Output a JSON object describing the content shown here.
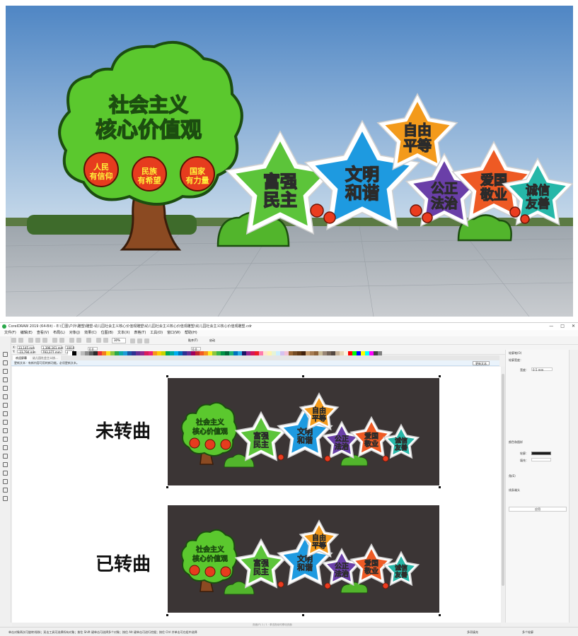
{
  "render": {
    "tree_title_line1": "社会主义",
    "tree_title_line2": "核心价值观",
    "apples": [
      {
        "line1": "人民",
        "line2": "有信仰"
      },
      {
        "line1": "民族",
        "line2": "有希望"
      },
      {
        "line1": "国家",
        "line2": "有力量"
      }
    ],
    "stars": [
      {
        "line1": "富强",
        "line2": "民主",
        "color": "#5cc43a"
      },
      {
        "line1": "文明",
        "line2": "和谐",
        "color": "#1e9ae0"
      },
      {
        "line1": "自由",
        "line2": "平等",
        "color": "#f39a1b"
      },
      {
        "line1": "公正",
        "line2": "法治",
        "color": "#6a3fa8"
      },
      {
        "line1": "爱国",
        "line2": "敬业",
        "color": "#ee5a24"
      },
      {
        "line1": "诚信",
        "line2": "友善",
        "color": "#26b7a8"
      }
    ]
  },
  "app": {
    "title": "CorelDRAW 2019 (64-Bit) - E:\\汇图\\户外\\雕塑\\雕塑-幼儿园社会主义核心价值观雕塑\\幼儿园社会主义核心价值观雕塑\\幼儿园社会主义核心价值观雕塑.cdr",
    "window_controls": [
      "—",
      "□",
      "✕"
    ],
    "menus": [
      "文件(F)",
      "编辑(E)",
      "查看(V)",
      "布局(L)",
      "对象(J)",
      "效果(C)",
      "位图(B)",
      "文本(X)",
      "表格(T)",
      "工具(O)",
      "窗口(W)",
      "帮助(H)"
    ],
    "zoom": "30%",
    "snap_label": "贴齐(T)",
    "launch_label": "启动",
    "coords": {
      "x": "33,145 mm",
      "y": "-23,794 mm",
      "w": "1,396,161 mm",
      "h": "793,377 mm",
      "sx": "100.0",
      "sy": "100.0",
      "angle": "0.0",
      "outline": "0.0"
    },
    "tabs": {
      "home": "欢迎屏幕",
      "doc": "幼儿园社会主义核..."
    },
    "infobar": {
      "text": "更新文本     ·  有新内容可用的新功能。必须更新文本。",
      "update": "更新文本"
    },
    "labels": {
      "unconverted": "未转曲",
      "converted": "已转曲"
    },
    "dock": {
      "title": "轮廓笔(O)",
      "outline_section": "轮廓宽度：",
      "width_label": "宽度：",
      "width_value": "0.5 mm",
      "color_section": "颜色和图样",
      "outline_color_label": "轮廓：",
      "fill_label": "填充：",
      "options_section": "角(E)",
      "options_section2": "线条端头",
      "button_label": "应用"
    },
    "hscroll_hint": "页面(P) 1 / 1  ·  单击拖动可移动页面",
    "status": {
      "hint": "单击对象两次可旋转/倾斜；双击工具可选择所有对象；按住 Shift 键单击可选择多个对象；按住 Alt 键单击可进行挖掘；按住 Ctrl 并单击可在组中选择",
      "fill": "多项填充",
      "stroke": "多个轮廓"
    },
    "palette": [
      "#ffffff",
      "#000000",
      "#e3e3e3",
      "#bcbcbc",
      "#8e8e8e",
      "#5d5d5d",
      "#2c2c2c",
      "#e9313a",
      "#f47c20",
      "#fbe11c",
      "#8cc63f",
      "#2aa84a",
      "#0da9a5",
      "#1d9bd7",
      "#1c55a6",
      "#2e3192",
      "#662d91",
      "#92278f",
      "#d91c5c",
      "#ed1e79",
      "#f7941d",
      "#ffcc00",
      "#c7d300",
      "#00a651",
      "#00a99d",
      "#00aeef",
      "#0072bc",
      "#2e3192",
      "#662d91",
      "#9e005d",
      "#c1272d",
      "#f15a24",
      "#f7931e",
      "#fcee21",
      "#8cc63f",
      "#39b54a",
      "#009245",
      "#006837",
      "#22b573",
      "#0071bc",
      "#29abe2",
      "#1b1464",
      "#93278f",
      "#d4145a",
      "#ed1c24",
      "#ff7bac",
      "#ffe5cc",
      "#fff3b0",
      "#e6f4d7",
      "#ccefff",
      "#d6c2f0",
      "#f4c2d7",
      "#996633",
      "#754c24",
      "#603813",
      "#42210b",
      "#c69c6d",
      "#a67c52",
      "#8c6239",
      "#ccbd99",
      "#998675",
      "#736357",
      "#534741",
      "#c7b299",
      "#e8d5b5",
      "#fcf4e2",
      "#ff0000",
      "#00ff00",
      "#0000ff",
      "#ffff00",
      "#00ffff",
      "#ff00ff",
      "#404040",
      "#808080"
    ]
  }
}
